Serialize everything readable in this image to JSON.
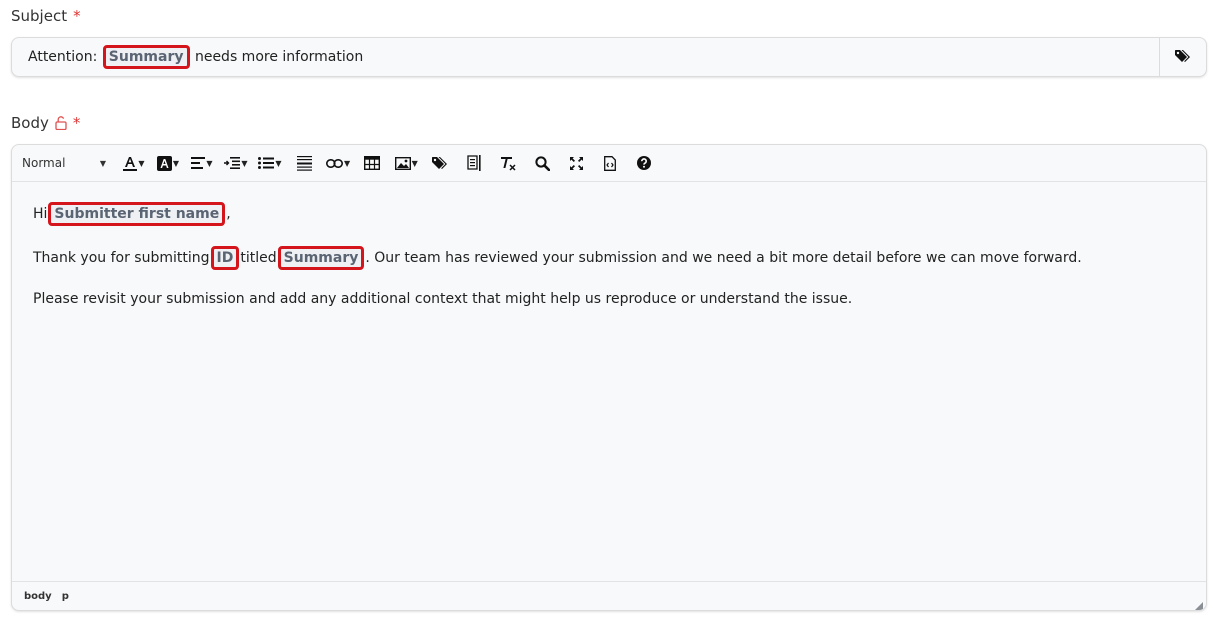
{
  "subject": {
    "label": "Subject",
    "required_mark": "*",
    "prefix": "Attention:",
    "chip": "Summary",
    "suffix": "needs more information",
    "tag_icon": "tags-icon"
  },
  "body": {
    "label": "Body",
    "lock_icon": "unlock-icon",
    "required_mark": "*"
  },
  "toolbar": {
    "format_value": "Normal"
  },
  "content": {
    "line1": {
      "prefix": "Hi",
      "chip": "Submitter first name",
      "suffix": ","
    },
    "line2": {
      "prefix": "Thank you for submitting",
      "chip1": "ID",
      "middle": "titled",
      "chip2": "Summary",
      "suffix": ". Our team has reviewed your submission and we need a bit more detail before we can move forward."
    },
    "line3": "Please revisit your submission and add any additional context that might help us reproduce or understand the issue."
  },
  "statusbar": {
    "path": [
      "body",
      "p"
    ]
  },
  "colors": {
    "required": "#dd3333",
    "chip_border": "#d4161c",
    "chip_text": "#5a6473"
  }
}
